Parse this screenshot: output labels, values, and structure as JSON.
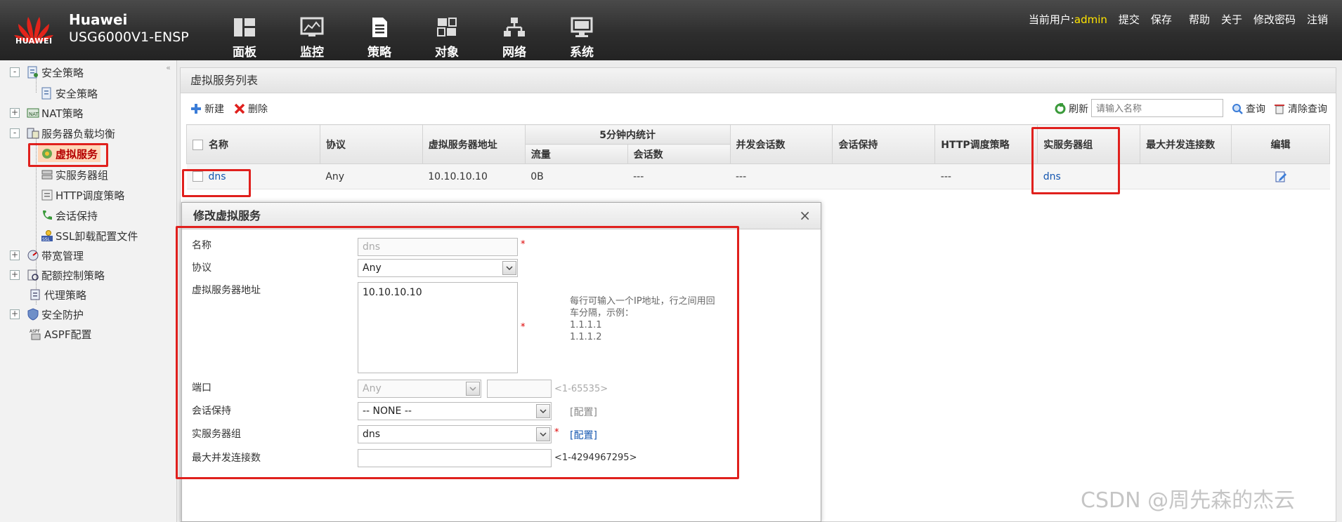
{
  "header": {
    "logo_text": "HUAWEI",
    "brand_name": "Huawei",
    "device_model": "USG6000V1-ENSP",
    "nav": [
      {
        "label": "面板",
        "icon": "dashboard-icon"
      },
      {
        "label": "监控",
        "icon": "monitor-icon"
      },
      {
        "label": "策略",
        "icon": "policy-icon"
      },
      {
        "label": "对象",
        "icon": "object-icon"
      },
      {
        "label": "网络",
        "icon": "network-icon"
      },
      {
        "label": "系统",
        "icon": "system-icon"
      }
    ],
    "current_user_label": "当前用户:",
    "current_user": "admin",
    "links": [
      "提交",
      "保存",
      "帮助",
      "关于",
      "修改密码",
      "注销"
    ]
  },
  "sidebar": {
    "items": [
      {
        "label": "安全策略",
        "expander": "-"
      },
      {
        "label": "安全策略"
      },
      {
        "label": "NAT策略",
        "expander": "+"
      },
      {
        "label": "服务器负载均衡",
        "expander": "-"
      },
      {
        "label": "虚拟服务",
        "selected": true
      },
      {
        "label": "实服务器组"
      },
      {
        "label": "HTTP调度策略"
      },
      {
        "label": "会话保持"
      },
      {
        "label": "SSL卸载配置文件"
      },
      {
        "label": "带宽管理",
        "expander": "+"
      },
      {
        "label": "配额控制策略",
        "expander": "+"
      },
      {
        "label": "代理策略"
      },
      {
        "label": "安全防护",
        "expander": "+"
      },
      {
        "label": "ASPF配置"
      }
    ]
  },
  "main": {
    "title": "虚拟服务列表",
    "toolbar": {
      "new_label": "新建",
      "delete_label": "删除",
      "refresh_label": "刷新",
      "search_placeholder": "请输入名称",
      "query_label": "查询",
      "clear_query_label": "清除查询"
    },
    "table": {
      "headers": {
        "name": "名称",
        "protocol": "协议",
        "vs_address": "虚拟服务器地址",
        "stats_group": "5分钟内统计",
        "traffic": "流量",
        "sessions": "会话数",
        "concurrent": "并发会话数",
        "persistence": "会话保持",
        "http_policy": "HTTP调度策略",
        "server_group": "实服务器组",
        "max_conn": "最大并发连接数",
        "edit": "编辑"
      },
      "rows": [
        {
          "name": "dns",
          "protocol": "Any",
          "vs_address": "10.10.10.10",
          "traffic": "0B",
          "sessions": "---",
          "concurrent": "---",
          "persistence": "",
          "http_policy": "---",
          "server_group": "dns",
          "max_conn": ""
        }
      ]
    }
  },
  "dialog": {
    "title": "修改虚拟服务",
    "close": "×",
    "fields": {
      "name_label": "名称",
      "name_value": "dns",
      "protocol_label": "协议",
      "protocol_value": "Any",
      "address_label": "虚拟服务器地址",
      "address_value": "10.10.10.10",
      "address_hint": [
        "每行可输入一个IP地址，行之间用回",
        "车分隔，示例：",
        "1.1.1.1",
        "1.1.1.2"
      ],
      "port_label": "端口",
      "port_select": "Any",
      "port_range": "<1-65535>",
      "persistence_label": "会话保持",
      "persistence_value": "-- NONE --",
      "persistence_cfg": "[配置]",
      "server_group_label": "实服务器组",
      "server_group_value": "dns",
      "server_group_cfg": "[配置]",
      "max_conn_label": "最大并发连接数",
      "max_conn_value": "",
      "max_conn_range": "<1-4294967295>",
      "required_mark": "*"
    }
  },
  "watermark": "CSDN @周先森的杰云",
  "colors": {
    "accent_red": "#e0201d",
    "link_blue": "#1557b0",
    "user_yellow": "#ffe400"
  }
}
